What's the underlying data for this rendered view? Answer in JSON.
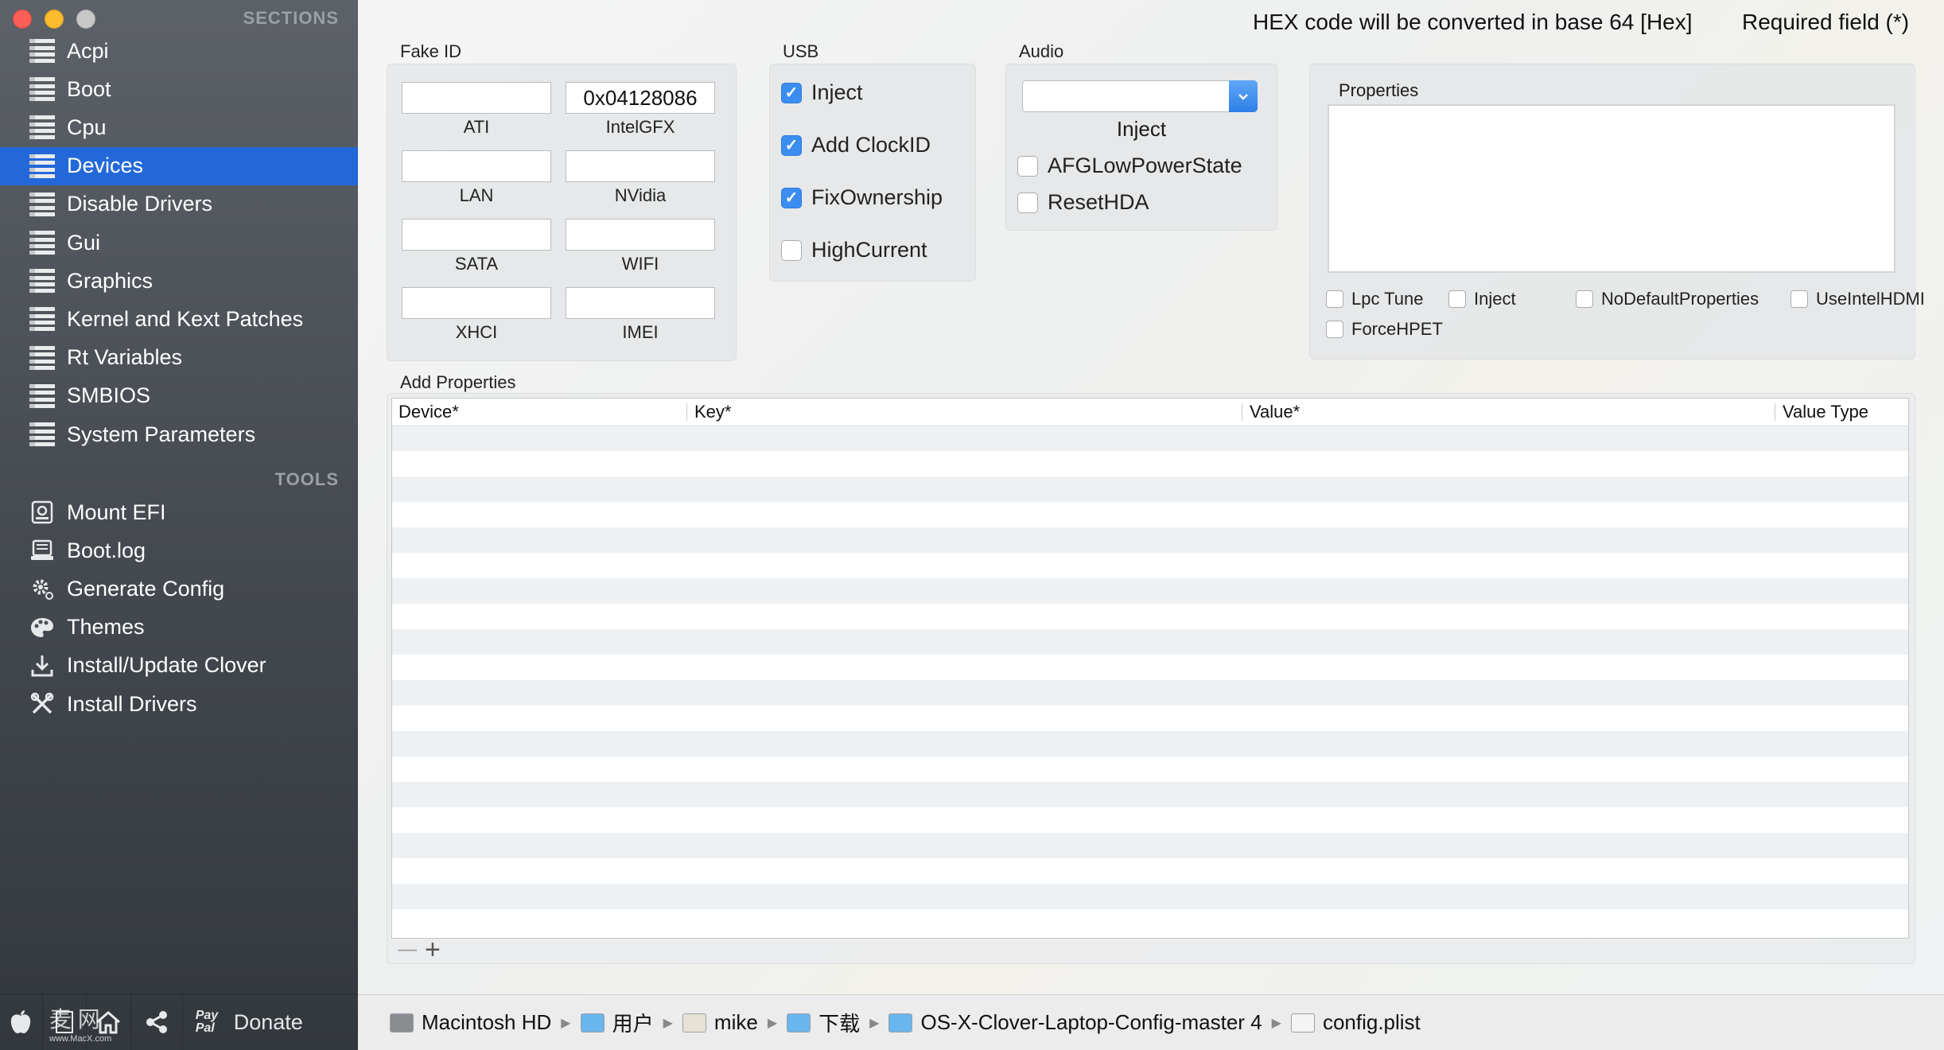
{
  "sidebar": {
    "sections_title": "SECTIONS",
    "sections": [
      {
        "label": "Acpi",
        "icon": "list-icon"
      },
      {
        "label": "Boot",
        "icon": "list-icon"
      },
      {
        "label": "Cpu",
        "icon": "list-icon"
      },
      {
        "label": "Devices",
        "icon": "list-icon",
        "selected": true
      },
      {
        "label": "Disable Drivers",
        "icon": "list-icon"
      },
      {
        "label": "Gui",
        "icon": "list-icon"
      },
      {
        "label": "Graphics",
        "icon": "list-icon"
      },
      {
        "label": "Kernel and Kext Patches",
        "icon": "list-icon"
      },
      {
        "label": "Rt Variables",
        "icon": "list-icon"
      },
      {
        "label": "SMBIOS",
        "icon": "list-icon"
      },
      {
        "label": "System Parameters",
        "icon": "list-icon"
      }
    ],
    "tools_title": "TOOLS",
    "tools": [
      {
        "label": "Mount EFI",
        "icon": "disk-icon"
      },
      {
        "label": "Boot.log",
        "icon": "log-icon"
      },
      {
        "label": "Generate Config",
        "icon": "gear-icon"
      },
      {
        "label": "Themes",
        "icon": "palette-icon"
      },
      {
        "label": "Install/Update Clover",
        "icon": "download-icon"
      },
      {
        "label": "Install Drivers",
        "icon": "tools-icon"
      }
    ],
    "bottom": {
      "donate_label": "Donate",
      "paypal_label": "Pay Pal",
      "watermark": "麦 网",
      "watermark_sub": "www.MacX.com"
    }
  },
  "header": {
    "hex_note": "HEX code will be converted in base 64 [Hex]",
    "required_note": "Required field (*)"
  },
  "fake_id": {
    "title": "Fake ID",
    "fields": [
      {
        "label": "ATI",
        "value": ""
      },
      {
        "label": "IntelGFX",
        "value": "0x04128086"
      },
      {
        "label": "LAN",
        "value": ""
      },
      {
        "label": "NVidia",
        "value": ""
      },
      {
        "label": "SATA",
        "value": ""
      },
      {
        "label": "WIFI",
        "value": ""
      },
      {
        "label": "XHCI",
        "value": ""
      },
      {
        "label": "IMEI",
        "value": ""
      }
    ]
  },
  "usb": {
    "title": "USB",
    "options": [
      {
        "label": "Inject",
        "checked": true
      },
      {
        "label": "Add ClockID",
        "checked": true
      },
      {
        "label": "FixOwnership",
        "checked": true
      },
      {
        "label": "HighCurrent",
        "checked": false
      }
    ]
  },
  "audio": {
    "title": "Audio",
    "inject_label": "Inject",
    "inject_value": "",
    "options": [
      {
        "label": "AFGLowPowerState",
        "checked": false
      },
      {
        "label": "ResetHDA",
        "checked": false
      }
    ]
  },
  "properties": {
    "title": "Properties",
    "options": [
      {
        "label": "Lpc Tune",
        "checked": false
      },
      {
        "label": "Inject",
        "checked": false
      },
      {
        "label": "NoDefaultProperties",
        "checked": false
      },
      {
        "label": "UseIntelHDMI",
        "checked": false
      },
      {
        "label": "ForceHPET",
        "checked": false
      }
    ]
  },
  "add_properties": {
    "title": "Add Properties",
    "columns": [
      "Device*",
      "Key*",
      "Value*",
      "Value Type"
    ],
    "remove_label": "—",
    "add_label": "+"
  },
  "pathbar": {
    "crumbs": [
      "Macintosh HD",
      "用户",
      "mike",
      "下载",
      "OS-X-Clover-Laptop-Config-master 4",
      "config.plist"
    ]
  },
  "colors": {
    "selection": "#2368d8",
    "checkbox_on": "#3b8ef0"
  }
}
